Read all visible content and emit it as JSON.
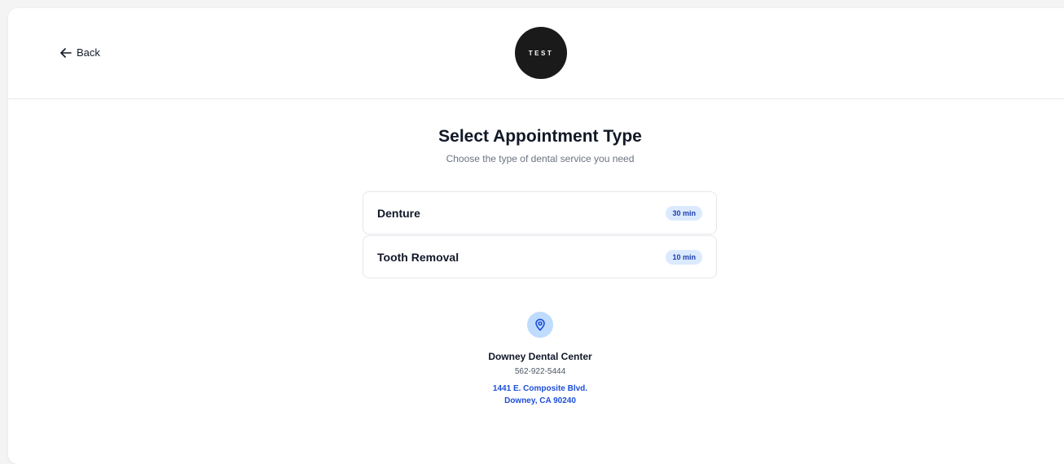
{
  "header": {
    "back_label": "Back",
    "logo_text": "TEST"
  },
  "main": {
    "title": "Select Appointment Type",
    "subtitle": "Choose the type of dental service you need",
    "appointments": [
      {
        "name": "Denture",
        "duration": "30 min"
      },
      {
        "name": "Tooth Removal",
        "duration": "10 min"
      }
    ]
  },
  "location": {
    "icon": "map-pin-icon",
    "name": "Downey Dental Center",
    "phone": "562-922-5444",
    "address_line1": "1441 E. Composite Blvd.",
    "address_line2": "Downey, CA 90240"
  },
  "colors": {
    "accent": "#1d4ed8",
    "badge_bg": "#dbeafe",
    "pin_bg": "#bfdbfe",
    "logo_bg": "#1a1a1a"
  }
}
